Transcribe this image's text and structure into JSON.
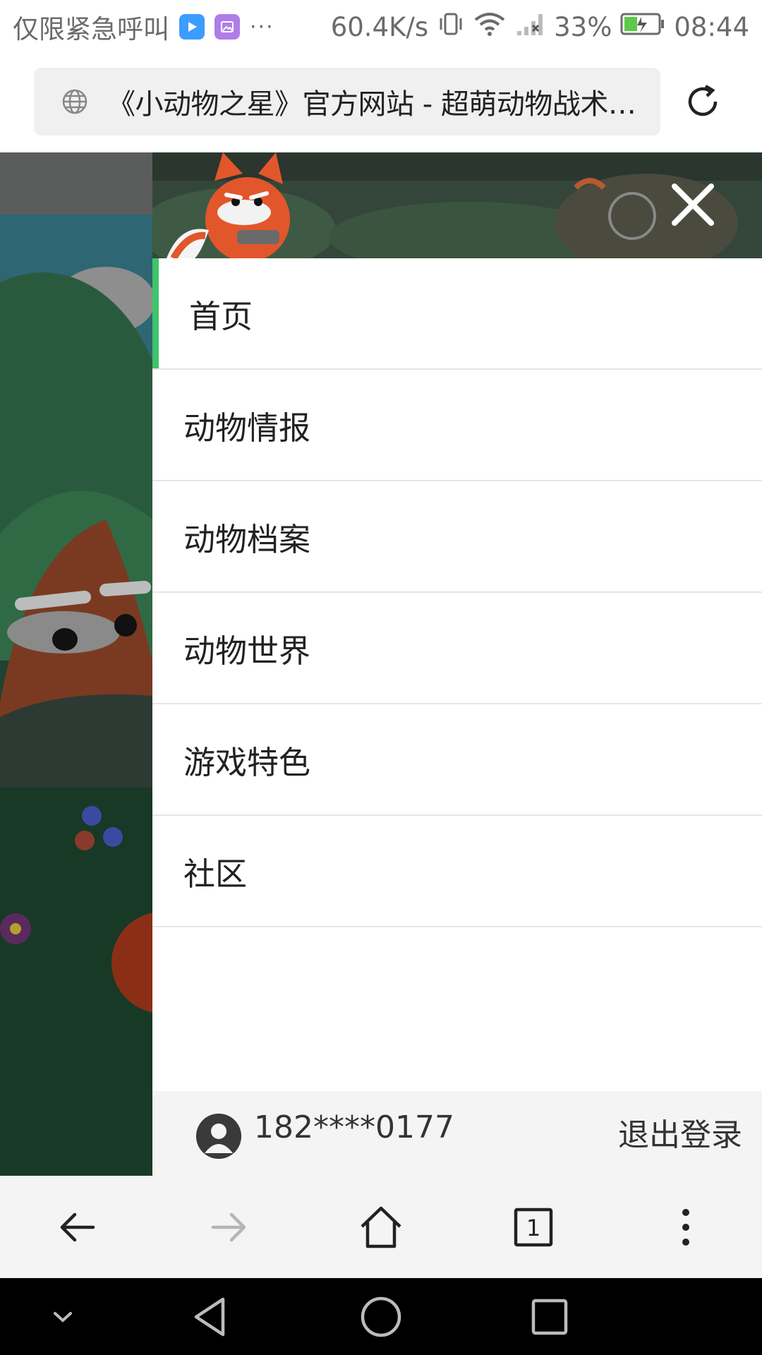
{
  "status_bar": {
    "left_text": "仅限紧急呼叫",
    "more_dots": "···",
    "speed": "60.4K/s",
    "battery": "33%",
    "time": "08:44",
    "icons": [
      "video-app-icon",
      "gallery-app-icon",
      "vibrate-icon",
      "wifi-icon",
      "signal-icon",
      "battery-charging-icon"
    ]
  },
  "address_bar": {
    "url_title": "《小动物之星》官方网站 - 超萌动物战术竞技游戏",
    "icons": [
      "globe-icon",
      "reload-icon"
    ]
  },
  "drawer": {
    "close_icon": "close-icon",
    "menu": [
      {
        "label": "首页",
        "active": true
      },
      {
        "label": "动物情报",
        "active": false
      },
      {
        "label": "动物档案",
        "active": false
      },
      {
        "label": "动物世界",
        "active": false
      },
      {
        "label": "游戏特色",
        "active": false
      },
      {
        "label": "社区",
        "active": false
      }
    ],
    "account": {
      "phone": "182****0177",
      "logout_label": "退出登录"
    }
  },
  "toolbar": {
    "buttons": [
      "back-icon",
      "forward-icon",
      "home-icon",
      "tabs-icon",
      "more-icon"
    ],
    "tab_count": "1"
  },
  "nav_bar": {
    "buttons": [
      "collapse-icon",
      "back-triangle-icon",
      "home-circle-icon",
      "recents-square-icon"
    ]
  },
  "colors": {
    "accent_active": "#3fc46a",
    "drawer_footer": "#f4f4f4",
    "scrim_art": "#1e3a2c"
  }
}
